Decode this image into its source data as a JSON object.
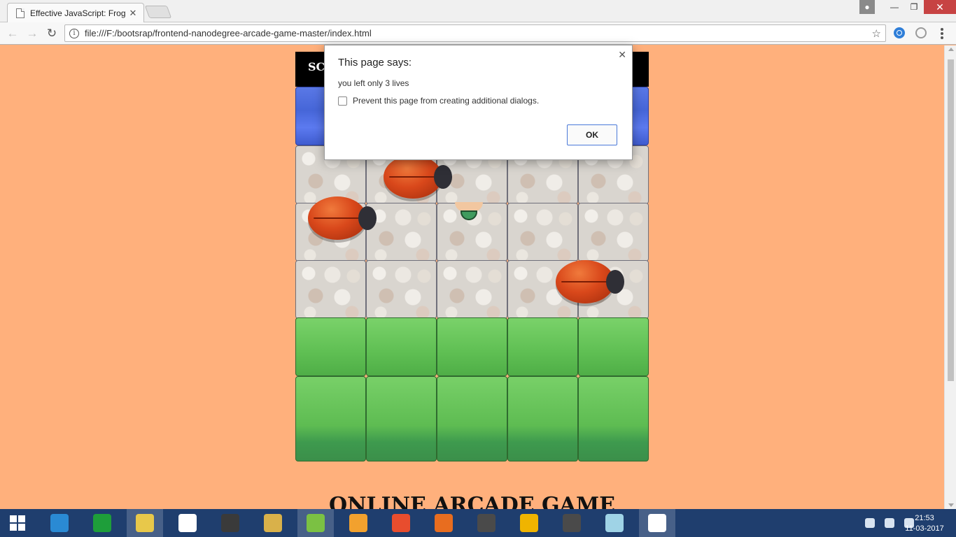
{
  "browser": {
    "tab_title": "Effective JavaScript: Frog",
    "url": "file:///F:/bootsrap/frontend-nanodegree-arcade-game-master/index.html"
  },
  "game": {
    "score_label": "SCO",
    "heading": "ONLINE ARCADE GAME"
  },
  "dialog": {
    "title": "This page says:",
    "message": "you left only 3 lives",
    "checkbox_label": "Prevent this page from creating additional dialogs.",
    "ok_label": "OK"
  },
  "taskbar": {
    "time": "21:53",
    "date": "11-03-2017",
    "apps": [
      {
        "name": "internet-explorer",
        "color": "#2a8ad4"
      },
      {
        "name": "store",
        "color": "#1e9e3a"
      },
      {
        "name": "file-explorer",
        "color": "#e8c84a"
      },
      {
        "name": "dropbox",
        "color": "#ffffff"
      },
      {
        "name": "paint",
        "color": "#3a3a3a"
      },
      {
        "name": "archive",
        "color": "#d9b14a"
      },
      {
        "name": "utorrent",
        "color": "#7bc143"
      },
      {
        "name": "uc-browser",
        "color": "#f2a12e"
      },
      {
        "name": "office",
        "color": "#e84d2e"
      },
      {
        "name": "firefox",
        "color": "#e86d1f"
      },
      {
        "name": "sublime-text",
        "color": "#4a4a4a"
      },
      {
        "name": "chrome-canary",
        "color": "#f0b400"
      },
      {
        "name": "sublime-text-2",
        "color": "#4a4a4a"
      },
      {
        "name": "notepad",
        "color": "#9fd3e6"
      },
      {
        "name": "chrome",
        "color": "#ffffff"
      }
    ]
  }
}
